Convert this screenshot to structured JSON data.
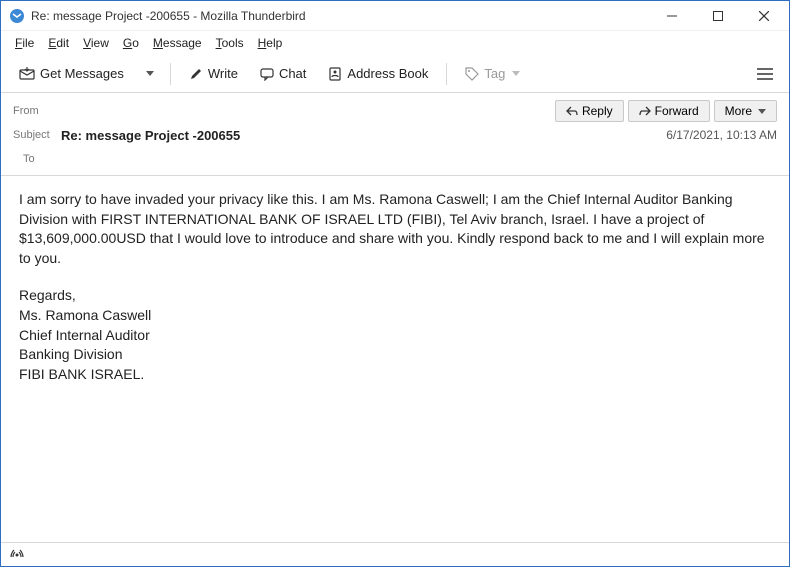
{
  "window": {
    "title": "Re: message Project -200655 - Mozilla Thunderbird"
  },
  "menu": {
    "file": "File",
    "edit": "Edit",
    "view": "View",
    "go": "Go",
    "message": "Message",
    "tools": "Tools",
    "help": "Help"
  },
  "toolbar": {
    "get_messages": "Get Messages",
    "write": "Write",
    "chat": "Chat",
    "address_book": "Address Book",
    "tag": "Tag"
  },
  "header": {
    "from_label": "From",
    "from_value": "",
    "subject_label": "Subject",
    "subject_value": "Re: message Project -200655",
    "to_label": "To",
    "to_value": "",
    "reply": "Reply",
    "forward": "Forward",
    "more": "More",
    "timestamp": "6/17/2021, 10:13 AM"
  },
  "body": {
    "paragraph1": "I am sorry to have invaded your privacy like this. I am Ms. Ramona Caswell; I am the Chief Internal Auditor Banking Division with FIRST INTERNATIONAL BANK OF ISRAEL LTD (FIBI), Tel Aviv branch, Israel. I have a project of $13,609,000.00USD that I would love to introduce and share with you. Kindly respond back to me and I will explain more to you.",
    "regards": "Regards,",
    "sig1": "Ms. Ramona Caswell",
    "sig2": "Chief Internal Auditor",
    "sig3": "Banking Division",
    "sig4": "FIBI BANK ISRAEL."
  },
  "status": {
    "remote_content": "((●))"
  }
}
